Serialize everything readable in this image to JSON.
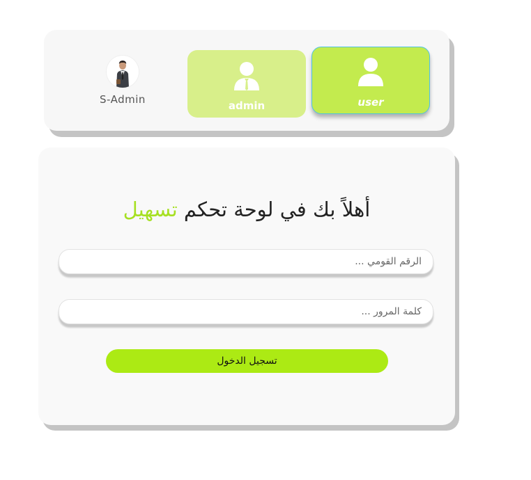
{
  "header": {
    "profile": {
      "name": "S-Admin",
      "avatar_icon": "person-avatar"
    },
    "roles": [
      {
        "id": "admin",
        "label": "admin",
        "icon": "admin-user-icon",
        "selected": false,
        "color": "#d8ef8a"
      },
      {
        "id": "user",
        "label": "user",
        "icon": "user-icon",
        "selected": true,
        "color": "#c3eb4e"
      }
    ]
  },
  "login": {
    "welcome_prefix": "أهلاً بك في لوحة تحكم",
    "brand_name": "تسهيل",
    "brand_color": "#a6e022",
    "national_id": {
      "placeholder": "الرقم القومي ...",
      "value": ""
    },
    "password": {
      "placeholder": "كلمة المرور ...",
      "value": ""
    },
    "submit_label": "تسجيل الدخول",
    "accent_color": "#acea14"
  }
}
